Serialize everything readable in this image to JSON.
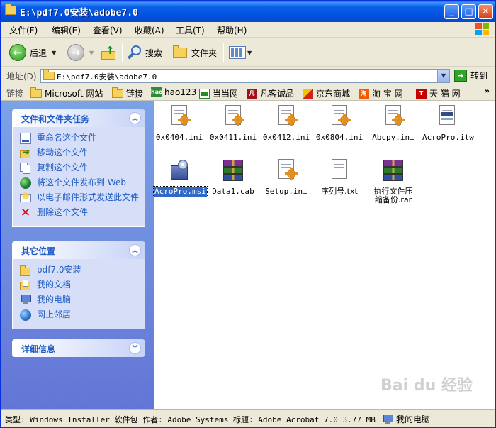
{
  "window": {
    "title": "E:\\pdf7.0安装\\adobe7.0",
    "minimize_label": "_",
    "maximize_label": "□",
    "close_label": "✕"
  },
  "menu": [
    {
      "label": "文件(F)"
    },
    {
      "label": "编辑(E)"
    },
    {
      "label": "查看(V)"
    },
    {
      "label": "收藏(A)"
    },
    {
      "label": "工具(T)"
    },
    {
      "label": "帮助(H)"
    }
  ],
  "toolbar": {
    "back_label": "后退",
    "search_label": "搜索",
    "folders_label": "文件夹"
  },
  "address": {
    "label": "地址(D)",
    "value": "E:\\pdf7.0安装\\adobe7.0",
    "go_label": "转到"
  },
  "links": {
    "label": "链接",
    "items": [
      {
        "label": "Microsoft 网站"
      },
      {
        "label": "链接"
      },
      {
        "label": "hao123",
        "icon_text": "hao"
      },
      {
        "label": "当当网"
      },
      {
        "label": "凡客诚品",
        "icon_text": "凡"
      },
      {
        "label": "京东商城"
      },
      {
        "label": "淘 宝 网",
        "icon_text": "淘"
      },
      {
        "label": "天 猫 网",
        "icon_text": "T"
      }
    ],
    "more_label": "»"
  },
  "tasks": {
    "file_tasks": {
      "title": "文件和文件夹任务",
      "toggle": "︽",
      "items": [
        {
          "label": "重命名这个文件"
        },
        {
          "label": "移动这个文件"
        },
        {
          "label": "复制这个文件"
        },
        {
          "label": "将这个文件发布到 Web"
        },
        {
          "label": "以电子邮件形式发送此文件"
        },
        {
          "label": "删除这个文件"
        }
      ]
    },
    "other_places": {
      "title": "其它位置",
      "toggle": "︽",
      "items": [
        {
          "label": "pdf7.0安装"
        },
        {
          "label": "我的文档"
        },
        {
          "label": "我的电脑"
        },
        {
          "label": "网上邻居"
        }
      ]
    },
    "details": {
      "title": "详细信息",
      "toggle": "︾"
    }
  },
  "files": [
    {
      "name": "0x0404.ini",
      "type": "ini"
    },
    {
      "name": "0x0411.ini",
      "type": "ini"
    },
    {
      "name": "0x0412.ini",
      "type": "ini"
    },
    {
      "name": "0x0804.ini",
      "type": "ini"
    },
    {
      "name": "Abcpy.ini",
      "type": "ini"
    },
    {
      "name": "AcroPro.itw",
      "type": "itw"
    },
    {
      "name": "AcroPro.msi",
      "type": "msi",
      "selected": true
    },
    {
      "name": "Data1.cab",
      "type": "rar"
    },
    {
      "name": "Setup.ini",
      "type": "ini"
    },
    {
      "name": "序列号.txt",
      "type": "txt"
    },
    {
      "name": "执行文件压缩备份.rar",
      "type": "rar"
    }
  ],
  "status": {
    "text": "类型: Windows Installer 软件包 作者: Adobe Systems 标题: Adobe Acrobat 7.0 3.77 MB",
    "zone": "我的电脑"
  },
  "watermark": "Bai du 经验",
  "colors": {
    "titlebar": "#0a5fe6",
    "task_pane": "#6375d6",
    "task_link": "#215dc6",
    "selection": "#316ac5"
  }
}
